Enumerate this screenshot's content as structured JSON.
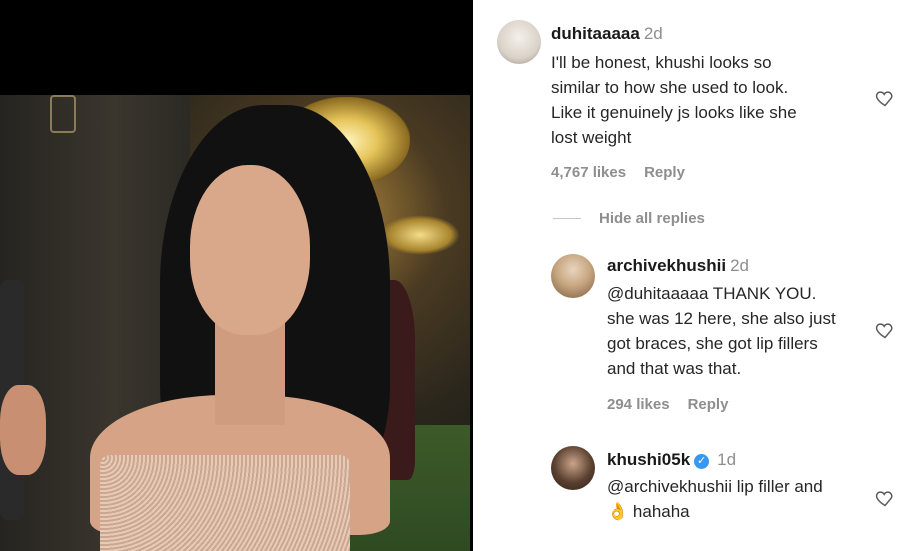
{
  "comments": [
    {
      "username": "duhitaaaaa",
      "time": "2d",
      "lines": [
        "I'll be honest, khushi looks so",
        "similar to how she used to look.",
        "Like it genuinely js looks like she",
        "lost weight"
      ],
      "likes": "4,767 likes",
      "reply_label": "Reply"
    },
    {
      "username": "archivekhushii",
      "time": "2d",
      "lines": [
        "@duhitaaaaa THANK YOU.",
        "she was 12 here, she also just",
        "got braces, she got lip fillers",
        "and that was that."
      ],
      "likes": "294 likes",
      "reply_label": "Reply"
    },
    {
      "username": "khushi05k",
      "time": "1d",
      "verified": true,
      "lines": [
        "@archivekhushii lip filler and",
        "hahaha"
      ],
      "emoji": "👌"
    }
  ],
  "hide_replies_label": "Hide all replies",
  "colors": {
    "text": "#262626",
    "muted": "#8e8e8e",
    "verified": "#3897f0"
  },
  "icons": [
    "heart-icon",
    "verified-badge-icon"
  ]
}
